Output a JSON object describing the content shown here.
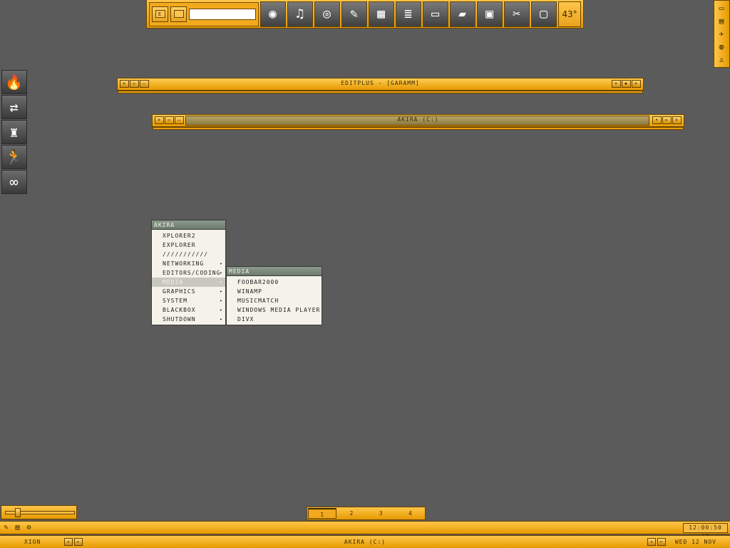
{
  "toolbar": {
    "prefix_button": "E",
    "launch_icons": [
      {
        "name": "cd-icon",
        "glyph": "◉"
      },
      {
        "name": "music-cd-icon",
        "glyph": "♫"
      },
      {
        "name": "burn-disc-icon",
        "glyph": "◎"
      },
      {
        "name": "graphics-tools-icon",
        "glyph": "✎"
      },
      {
        "name": "windows-flag-icon",
        "glyph": "▦"
      },
      {
        "name": "document-icon",
        "glyph": "≣"
      },
      {
        "name": "ftp-folder-icon",
        "glyph": "▭"
      },
      {
        "name": "drive-icon",
        "glyph": "▰"
      },
      {
        "name": "monitor-icon",
        "glyph": "▣"
      },
      {
        "name": "tools-icon",
        "glyph": "✂"
      },
      {
        "name": "window-icon",
        "glyph": "▢"
      }
    ],
    "temperature": "43°"
  },
  "right_tray_icons": [
    "monitor-icon",
    "folder-icon",
    "bird-icon",
    "globe-icon",
    "user-icon"
  ],
  "left_dock_icons": [
    {
      "name": "firewall-icon",
      "glyph": "🔥"
    },
    {
      "name": "network-icon",
      "glyph": "⇄"
    },
    {
      "name": "chess-icon",
      "glyph": "♜"
    },
    {
      "name": "aim-runner-icon",
      "glyph": "🏃"
    },
    {
      "name": "link-icon",
      "glyph": "∞"
    }
  ],
  "windows": [
    {
      "title": "EDITPLUS - [GARAMM]"
    },
    {
      "title": "AKIRA (C:)"
    }
  ],
  "root_menu": {
    "title": "AKIRA",
    "items": [
      {
        "label": "XPLORER2",
        "submenu": false
      },
      {
        "label": "EXPLORER",
        "submenu": false
      },
      {
        "label": "///////////",
        "submenu": false
      },
      {
        "label": "NETWORKING",
        "submenu": true
      },
      {
        "label": "EDITORS/CODING",
        "submenu": true
      },
      {
        "label": "MEDIA",
        "submenu": true,
        "selected": true
      },
      {
        "label": "GRAPHICS",
        "submenu": true
      },
      {
        "label": "SYSTEM",
        "submenu": true
      },
      {
        "label": "BLACKBOX",
        "submenu": true
      },
      {
        "label": "SHUTDOWN",
        "submenu": true
      }
    ]
  },
  "media_menu": {
    "title": "MEDIA",
    "items": [
      "FOOBAR2000",
      "WINAMP",
      "MUSICMATCH",
      "WINDOWS MEDIA PLAYER",
      "DIVX"
    ]
  },
  "volume_slider": {
    "level_fraction": 0.15
  },
  "workspaces": [
    "1",
    "2",
    "3",
    "4"
  ],
  "active_workspace": "1",
  "clock": "12:00:50 AM",
  "status": {
    "workspace_label": "XION",
    "current_task": "AKIRA (C:)",
    "date": "WED 12 NOV"
  },
  "colors": {
    "accent": "#e69a00",
    "menu_header": "#7c8a7b",
    "desktop": "#5b5b5b"
  }
}
